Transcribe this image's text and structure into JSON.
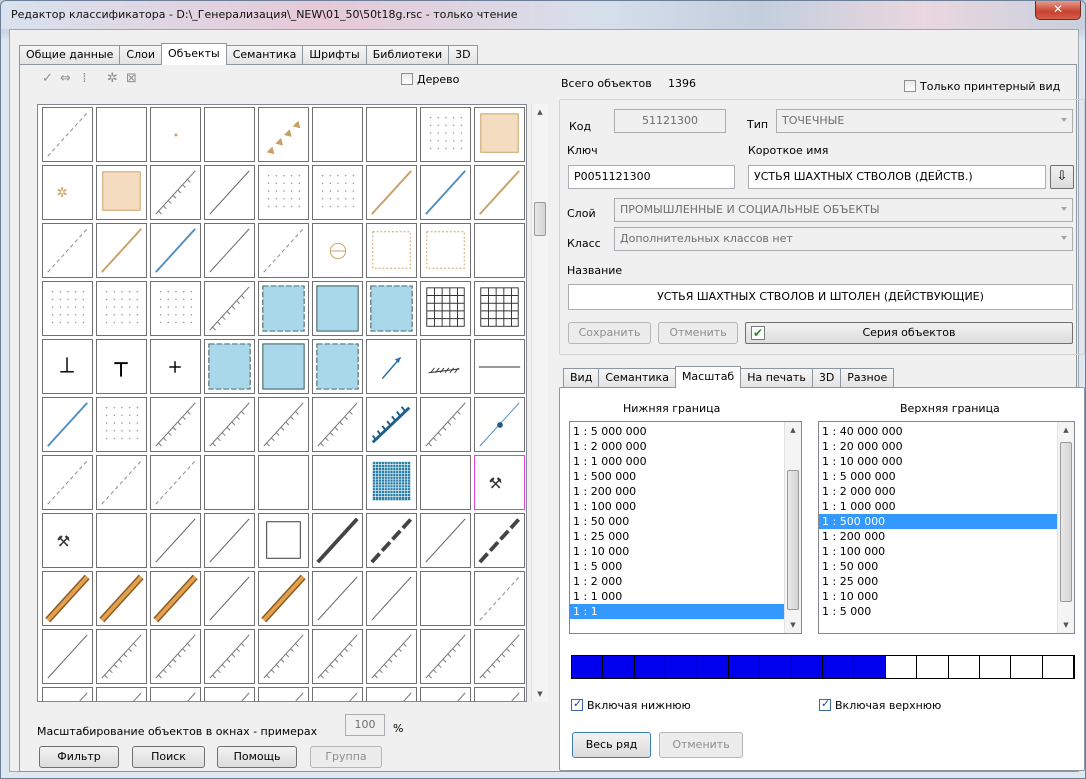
{
  "window": {
    "title": "Редактор классификатора - D:\\_Генерализация\\_NEW\\01_50\\50t18g.rsc - только чтение",
    "close_icon": "close-icon"
  },
  "tabs": [
    "Общие данные",
    "Слои",
    "Объекты",
    "Семантика",
    "Шрифты",
    "Библиотеки",
    "3D"
  ],
  "active_tab": 2,
  "toolbar": {
    "tree_label": "Дерево"
  },
  "grid": {
    "selected_index": 62
  },
  "left_bottom": {
    "scale_label": "Масштабирование объектов в окнах - примерах",
    "scale_value": "100",
    "percent": "%",
    "filter": "Фильтр",
    "search": "Поиск",
    "help": "Помощь",
    "group": "Группа"
  },
  "header": {
    "total_label": "Всего объектов",
    "total_value": "1396",
    "printer_only": "Только принтерный вид"
  },
  "form": {
    "code_label": "Код",
    "code_value": "51121300",
    "type_label": "Тип",
    "type_value": "ТОЧЕЧНЫЕ",
    "key_label": "Ключ",
    "key_value": "P0051121300",
    "short_label": "Короткое имя",
    "short_value": "УСТЬЯ ШАХТНЫХ СТВОЛОВ (ДЕЙСТВ.)",
    "layer_label": "Слой",
    "layer_value": "ПРОМЫШЛЕННЫЕ И СОЦИАЛЬНЫЕ ОБЪЕКТЫ",
    "class_label": "Класс",
    "class_value": "Дополнительных классов нет",
    "name_label": "Название",
    "name_value": "УСТЬЯ ШАХТНЫХ СТВОЛОВ  И ШТОЛЕН (ДЕЙСТВУЮЩИЕ)",
    "save": "Сохранить",
    "cancel": "Отменить",
    "series": "Серия объектов"
  },
  "subtabs": [
    "Вид",
    "Семантика",
    "Масштаб",
    "На печать",
    "3D",
    "Разное"
  ],
  "active_subtab": 2,
  "scale": {
    "lower_title": "Нижняя граница",
    "upper_title": "Верхняя граница",
    "lower": [
      "1 : 5 000 000",
      "1 : 2 000 000",
      "1 : 1 000 000",
      "1 : 500 000",
      "1 : 200 000",
      "1 : 100 000",
      "1 : 50 000",
      "1 : 25 000",
      "1 : 10 000",
      "1 : 5 000",
      "1 : 2 000",
      "1 : 1 000",
      "1 : 1"
    ],
    "lower_selected": 12,
    "upper": [
      "1 : 40 000 000",
      "1 : 20 000 000",
      "1 : 10 000 000",
      "1 : 5 000 000",
      "1 : 2 000 000",
      "1 : 1 000 000",
      "1 : 500 000",
      "1 : 200 000",
      "1 : 100 000",
      "1 : 50 000",
      "1 : 25 000",
      "1 : 10 000",
      "1 : 5 000"
    ],
    "upper_selected": 6,
    "range_filled": 10,
    "range_total": 16,
    "include_lower": "Включая нижнюю",
    "include_upper": "Включая верхнюю",
    "whole_row": "Весь ряд",
    "cancel": "Отменить"
  },
  "colors": {
    "accent": "#3399ff",
    "range": "#0000ee",
    "symbol_fill": "#a8d8ea",
    "symbol_line": "#c8a064"
  }
}
